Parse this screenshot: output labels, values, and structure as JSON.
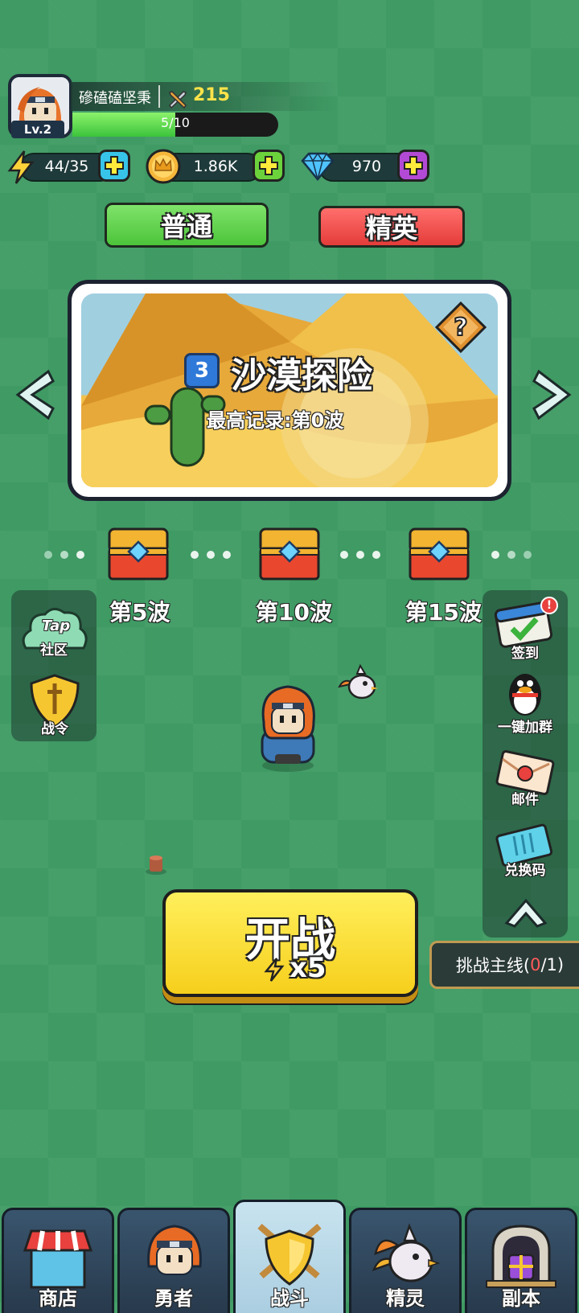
{
  "player": {
    "name": "磣磕磕坚秉",
    "level": "Lv.2",
    "power": "215",
    "exp": "5/10",
    "exp_fraction": 0.5
  },
  "resources": {
    "energy": "44/35",
    "gold": "1.86K",
    "gems": "970"
  },
  "modes": {
    "normal": "普通",
    "elite": "精英"
  },
  "stage": {
    "number": "3",
    "title": "沙漠探险",
    "record": "最高记录:第0波",
    "help_icon": "?"
  },
  "rewards": [
    {
      "label": "第5波"
    },
    {
      "label": "第10波"
    },
    {
      "label": "第15波"
    }
  ],
  "left_panel": {
    "community_tap": "Tap",
    "community": "社区",
    "battle_pass": "战令"
  },
  "right_panel": {
    "checkin": "签到",
    "join_group": "一键加群",
    "mail": "邮件",
    "redeem": "兑换码",
    "badge": "!"
  },
  "fight": {
    "label": "开战",
    "cost": "x5"
  },
  "challenge": {
    "label": "挑战主线(",
    "progress": "0",
    "total": "/1)"
  },
  "nav": {
    "shop": "商店",
    "hero": "勇者",
    "battle": "战斗",
    "spirit": "精灵",
    "dungeon": "副本"
  },
  "colors": {
    "background": "#3f9a63",
    "normal_btn": "#5fd34a",
    "elite_btn": "#ee4a48",
    "fight_btn": "#f6cf1c",
    "power_text": "#ffe34a",
    "progress_red": "#ff5a5a"
  }
}
